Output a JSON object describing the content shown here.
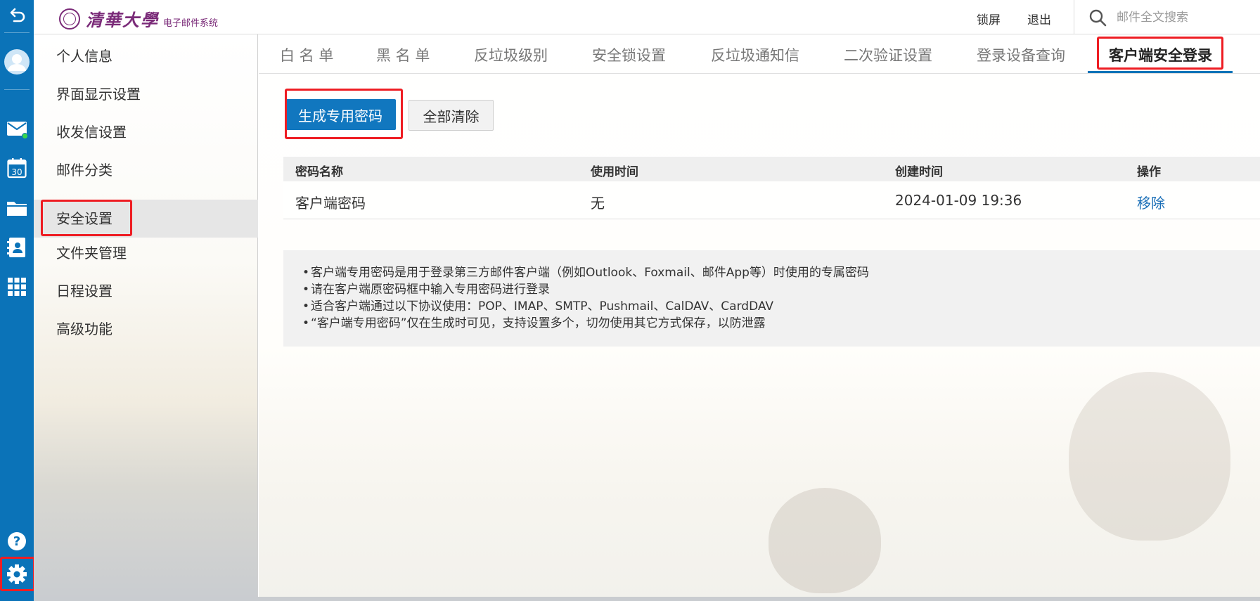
{
  "brand": {
    "logo_calligraphy": "清華大學",
    "logo_subtitle": "电子邮件系统",
    "accent_color": "#0b73b8",
    "highlight_color": "#ee1d23"
  },
  "header": {
    "lock_label": "锁屏",
    "logout_label": "退出",
    "search_placeholder": "邮件全文搜索",
    "search_icon": "search-icon"
  },
  "rail": {
    "icons": [
      "back-icon",
      "avatar-icon",
      "mail-icon",
      "calendar-icon",
      "folder-icon",
      "contacts-icon",
      "apps-grid-icon",
      "help-icon",
      "settings-gear-icon"
    ],
    "calendar_day": "30"
  },
  "sidebar": {
    "items": [
      {
        "label": "个人信息"
      },
      {
        "label": "界面显示设置"
      },
      {
        "label": "收发信设置"
      },
      {
        "label": "邮件分类"
      },
      {
        "label": "安全设置",
        "active": true
      },
      {
        "label": "文件夹管理"
      },
      {
        "label": "日程设置"
      },
      {
        "label": "高级功能"
      }
    ]
  },
  "tabs": [
    {
      "label": "白 名 单"
    },
    {
      "label": "黑 名 单"
    },
    {
      "label": "反垃圾级别"
    },
    {
      "label": "安全锁设置"
    },
    {
      "label": "反垃圾通知信"
    },
    {
      "label": "二次验证设置"
    },
    {
      "label": "登录设备查询"
    },
    {
      "label": "客户端安全登录",
      "active": true
    }
  ],
  "actions": {
    "generate_label": "生成专用密码",
    "clear_all_label": "全部清除"
  },
  "table": {
    "columns": [
      "密码名称",
      "使用时间",
      "创建时间",
      "操作"
    ],
    "rows": [
      {
        "name": "客户端密码",
        "used": "无",
        "created": "2024-01-09 19:36",
        "action": "移除"
      }
    ]
  },
  "notes": [
    "客户端专用密码是用于登录第三方邮件客户端（例如Outlook、Foxmail、邮件App等）时使用的专属密码",
    "请在客户端原密码框中输入专用密码进行登录",
    "适合客户端通过以下协议使用：POP、IMAP、SMTP、Pushmail、CalDAV、CardDAV",
    "“客户端专用密码”仅在生成时可见，支持设置多个，切勿使用其它方式保存，以防泄露"
  ]
}
